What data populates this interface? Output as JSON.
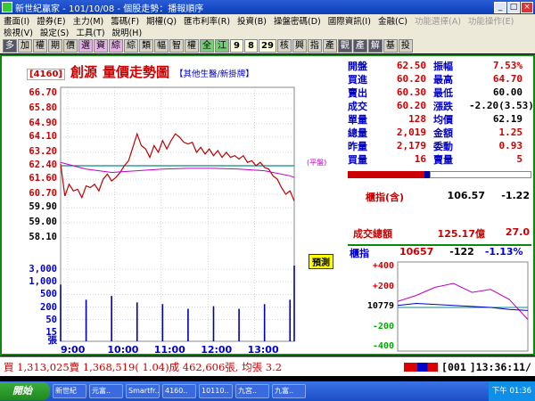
{
  "window": {
    "title": "新世紀贏家 - 101/10/08 - 個股走勢：播報順序",
    "min": "_",
    "max": "□",
    "close": "×"
  },
  "menu1": [
    "畫面(I)",
    "證券(E)",
    "主力(M)",
    "籌碼(F)",
    "期權(Q)",
    "匯市利率(R)",
    "投資(B)",
    "操盤密碼(D)",
    "國際資訊(I)",
    "金融(C)",
    "功能選擇(A)",
    "功能操作(E)"
  ],
  "menu2": [
    "檢視(V)",
    "設定(S)",
    "工具(T)",
    "說明(H)"
  ],
  "toolbar": [
    "多",
    "加",
    "權",
    "期",
    "價",
    "選",
    "資",
    "綜",
    "綜",
    "類",
    "幅",
    "智",
    "權",
    "全",
    "江",
    "9",
    "8",
    "29",
    "核",
    "興",
    "指",
    "產",
    "觀",
    "產",
    "解",
    "基",
    "投"
  ],
  "chart": {
    "stock_code": "[4160]",
    "stock_name": "創源",
    "chart_type": "量價走勢圖",
    "link": "【其他生醫/新掛牌】",
    "ref_label": "(平盤)",
    "forecast_label": "預測",
    "volume_unit": "張"
  },
  "chart_data": {
    "type": "line",
    "title": "量價走勢圖",
    "price_ticks": [
      "66.70",
      "65.80",
      "64.90",
      "64.10",
      "63.20",
      "62.40",
      "61.60",
      "60.70",
      "59.90",
      "59.00",
      "58.10"
    ],
    "volume_ticks": [
      "3,000",
      "1,000",
      "500",
      "200",
      "50",
      "15"
    ],
    "time_ticks": [
      "9:00",
      "10:00",
      "11:00",
      "12:00",
      "13:00"
    ],
    "ylim": [
      58.1,
      66.7
    ],
    "reference_price": 62.4,
    "series": [
      {
        "color": "#c00000",
        "x": [
          0,
          5,
          10,
          15,
          20,
          25,
          30,
          35,
          40,
          45,
          50,
          55,
          60,
          65,
          70,
          75,
          80,
          85,
          90,
          95,
          100,
          105,
          110,
          115,
          120,
          125,
          130,
          135,
          140,
          145,
          150,
          155,
          160,
          165,
          170,
          175,
          180,
          185,
          190,
          195,
          200,
          205,
          210,
          215,
          220,
          225,
          230,
          235,
          240,
          245,
          250,
          255,
          260,
          265,
          270,
          275
        ],
        "values": [
          62.5,
          60.6,
          61.3,
          60.9,
          61.0,
          60.5,
          61.2,
          61.1,
          61.3,
          60.9,
          61.6,
          61.9,
          61.5,
          61.7,
          62.0,
          62.4,
          62.7,
          63.5,
          64.3,
          63.6,
          63.4,
          62.9,
          63.6,
          63.2,
          63.9,
          63.4,
          63.9,
          64.3,
          64.1,
          63.8,
          63.7,
          63.8,
          63.2,
          63.5,
          63.1,
          63.4,
          63.0,
          63.3,
          62.9,
          63.2,
          62.9,
          63.0,
          62.8,
          63.0,
          62.6,
          62.7,
          62.4,
          62.6,
          62.3,
          62.2,
          61.8,
          61.6,
          61.1,
          60.7,
          60.9,
          60.3
        ]
      },
      {
        "color": "#c000c0",
        "x": [
          0,
          30,
          60,
          90,
          120,
          150,
          180,
          210,
          240,
          270,
          275
        ],
        "values": [
          62.6,
          62.2,
          62.0,
          62.1,
          62.2,
          62.25,
          62.25,
          62.2,
          62.1,
          61.8,
          61.7
        ]
      }
    ],
    "volume": {
      "x": [
        0,
        30,
        60,
        90,
        120,
        150,
        180,
        210,
        240,
        270,
        275
      ],
      "values": [
        400,
        80,
        120,
        60,
        50,
        30,
        40,
        30,
        50,
        80,
        3000
      ]
    }
  },
  "quote": [
    {
      "k": "開盤",
      "v": "62.50",
      "k2": "振幅",
      "v2": "7.53%"
    },
    {
      "k": "買進",
      "v": "60.20",
      "k2": "最高",
      "v2": "64.70"
    },
    {
      "k": "賣出",
      "v": "60.30",
      "k2": "最低",
      "v2": "60.00",
      "dark2": true
    },
    {
      "k": "成交",
      "v": "60.20",
      "k2": "漲跌",
      "v2": "-2.20(3.53)",
      "dark2": true
    },
    {
      "k": "單量",
      "v": "128",
      "k2": "均價",
      "v2": "62.19",
      "dark2": true
    },
    {
      "k": "總量",
      "v": "2,019",
      "k2": "金額",
      "v2": "1.25"
    },
    {
      "k": "昨量",
      "v": "2,179",
      "k2": "委動",
      "v2": "0.93"
    },
    {
      "k": "買量",
      "v": "16",
      "k2": "賣量",
      "v2": "5"
    }
  ],
  "index": {
    "label": "櫃指(含)",
    "value": "106.57",
    "change": "-1.22"
  },
  "turnover": {
    "label": "成交總額",
    "value": "125.17億",
    "extra": "27.0"
  },
  "mini": {
    "label": "櫃指",
    "value": "10657",
    "change": "-122",
    "pct": "-1.13%",
    "ticks": [
      "+400",
      "+200",
      "10779",
      "-200",
      "-400"
    ],
    "chart_data": {
      "type": "line",
      "series": [
        {
          "color": "#c000c0",
          "x": [
            0,
            20,
            40,
            60,
            80,
            100,
            120,
            140
          ],
          "values": [
            60,
            120,
            200,
            240,
            150,
            180,
            80,
            -120
          ]
        },
        {
          "color": "#0000c0",
          "x": [
            0,
            20,
            40,
            60,
            80,
            100,
            120,
            140
          ],
          "values": [
            20,
            40,
            30,
            20,
            10,
            0,
            -20,
            -30
          ]
        }
      ],
      "ylim": [
        -400,
        400
      ]
    }
  },
  "status": {
    "text": "買 1,313,025賣 1,368,519( 1.04)成 462,606張, 均張 3.2",
    "code": "[001",
    "time": "]13:36:11/"
  },
  "taskbar": {
    "start": "開始",
    "tasks": [
      "新世紀",
      "元富..",
      "Smartfr..",
      "4160..",
      "10110..",
      "九宮..",
      "九富.."
    ],
    "clock": "下午 01:36"
  }
}
